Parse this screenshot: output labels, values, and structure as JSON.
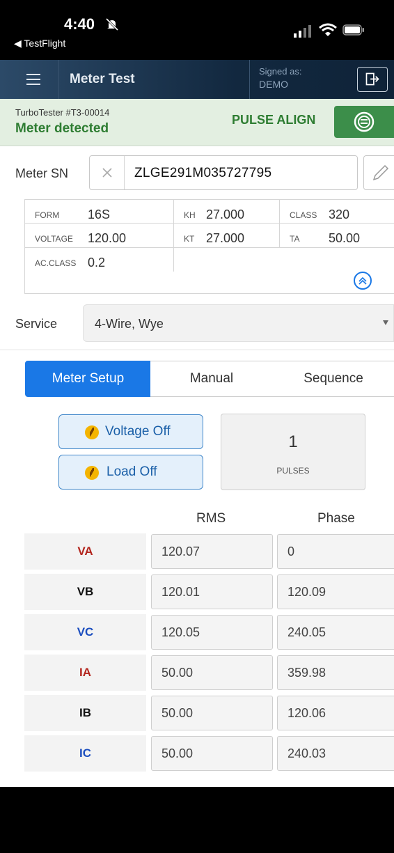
{
  "status_bar": {
    "time": "4:40",
    "back_app": "◀ TestFlight"
  },
  "header": {
    "title": "Meter Test",
    "signed_as_label": "Signed as:",
    "user": "DEMO"
  },
  "device": {
    "id": "TurboTester #T3-00014",
    "state": "Meter detected",
    "action": "PULSE ALIGN"
  },
  "meter": {
    "sn_label": "Meter SN",
    "serial": "ZLGE291M035727795"
  },
  "info": {
    "form_label": "FORM",
    "form": "16S",
    "kh_label": "KH",
    "kh": "27.000",
    "class_label": "CLASS",
    "class": "320",
    "voltage_label": "VOLTAGE",
    "voltage": "120.00",
    "kt_label": "KT",
    "kt": "27.000",
    "ta_label": "TA",
    "ta": "50.00",
    "acclass_label": "AC.CLASS",
    "acclass": "0.2"
  },
  "service": {
    "label": "Service",
    "value": "4-Wire, Wye"
  },
  "tabs": [
    "Meter Setup",
    "Manual",
    "Sequence"
  ],
  "controls": {
    "voltage": "Voltage Off",
    "load": "Load Off",
    "pulses_count": "1",
    "pulses_label": "PULSES"
  },
  "readings": {
    "headers": {
      "rms": "RMS",
      "phase": "Phase"
    },
    "rows": [
      {
        "label": "VA",
        "rms": "120.07",
        "phase": "0"
      },
      {
        "label": "VB",
        "rms": "120.01",
        "phase": "120.09"
      },
      {
        "label": "VC",
        "rms": "120.05",
        "phase": "240.05"
      },
      {
        "label": "IA",
        "rms": "50.00",
        "phase": "359.98"
      },
      {
        "label": "IB",
        "rms": "50.00",
        "phase": "120.06"
      },
      {
        "label": "IC",
        "rms": "50.00",
        "phase": "240.03"
      }
    ]
  },
  "colors": {
    "accent": "#1a78e6",
    "ok_green": "#2e7d32",
    "phase_a": "#b3261e",
    "phase_b": "#111111",
    "phase_c": "#1d4fbf"
  }
}
